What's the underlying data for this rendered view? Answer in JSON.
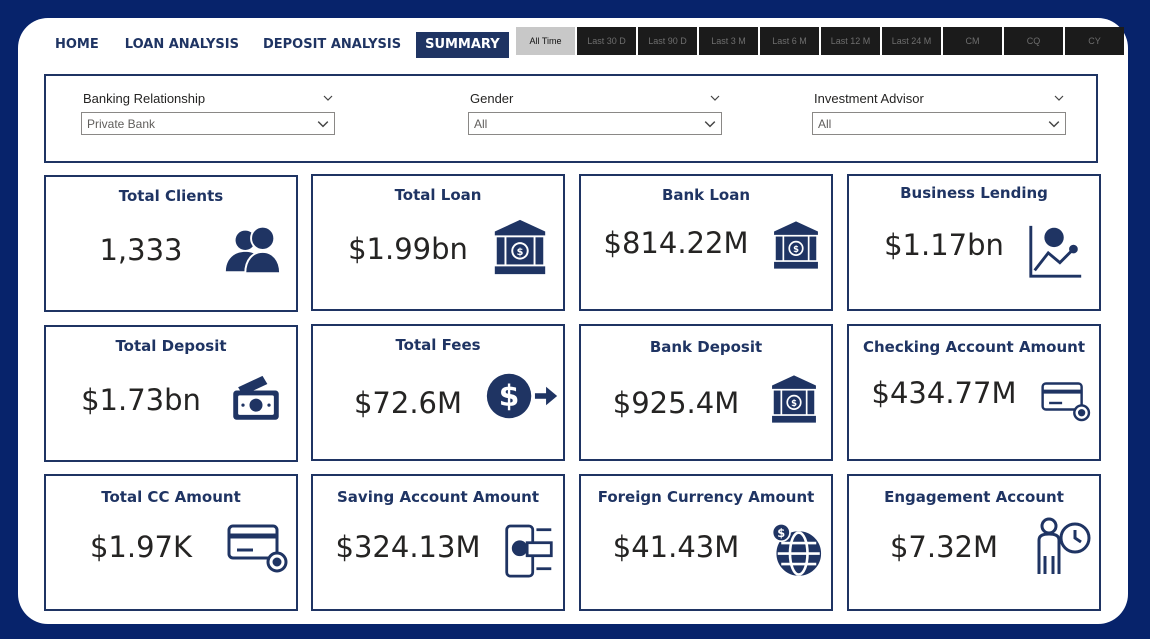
{
  "nav": {
    "items": [
      {
        "label": "HOME",
        "active": false
      },
      {
        "label": "LOAN ANALYSIS",
        "active": false
      },
      {
        "label": "DEPOSIT ANALYSIS",
        "active": false
      },
      {
        "label": "SUMMARY",
        "active": true
      }
    ]
  },
  "time_filters": {
    "items": [
      "All Time",
      "Last 30 D",
      "Last 90 D",
      "Last 3 M",
      "Last 6 M",
      "Last 12 M",
      "Last 24 M",
      "CM",
      "CQ",
      "CY"
    ],
    "selected": "All Time"
  },
  "filters": {
    "banking_relationship": {
      "label": "Banking Relationship",
      "value": "Private Bank"
    },
    "gender": {
      "label": "Gender",
      "value": "All"
    },
    "investment_advisor": {
      "label": "Investment Advisor",
      "value": "All"
    }
  },
  "kpis": {
    "total_clients": {
      "title": "Total Clients",
      "value": "1,333",
      "icon": "clients-icon"
    },
    "total_loan": {
      "title": "Total Loan",
      "value": "$1.99bn",
      "icon": "bank-icon"
    },
    "bank_loan": {
      "title": "Bank Loan",
      "value": "$814.22M",
      "icon": "bank-icon"
    },
    "business_lending": {
      "title": "Business Lending",
      "value": "$1.17bn",
      "icon": "growth-chart-icon"
    },
    "total_deposit": {
      "title": "Total Deposit",
      "value": "$1.73bn",
      "icon": "cash-icon"
    },
    "total_fees": {
      "title": "Total Fees",
      "value": "$72.6M",
      "icon": "dollar-transfer-icon"
    },
    "bank_deposit": {
      "title": "Bank Deposit",
      "value": "$925.4M",
      "icon": "bank-icon"
    },
    "checking_account": {
      "title": "Checking Account Amount",
      "value": "$434.77M",
      "icon": "credit-card-settings-icon"
    },
    "total_cc": {
      "title": "Total CC Amount",
      "value": "$1.97K",
      "icon": "credit-card-settings-icon"
    },
    "saving_account": {
      "title": "Saving Account Amount",
      "value": "$324.13M",
      "icon": "mobile-payment-icon"
    },
    "foreign_currency": {
      "title": "Foreign Currency Amount",
      "value": "$41.43M",
      "icon": "globe-dollar-icon"
    },
    "engagement_account": {
      "title": "Engagement Account",
      "value": "$7.32M",
      "icon": "person-clock-icon"
    }
  },
  "colors": {
    "background": "#07236b",
    "accent": "#1f3463",
    "slicer_dark": "#1b1b1b",
    "slicer_selected": "#c8c8c8"
  }
}
